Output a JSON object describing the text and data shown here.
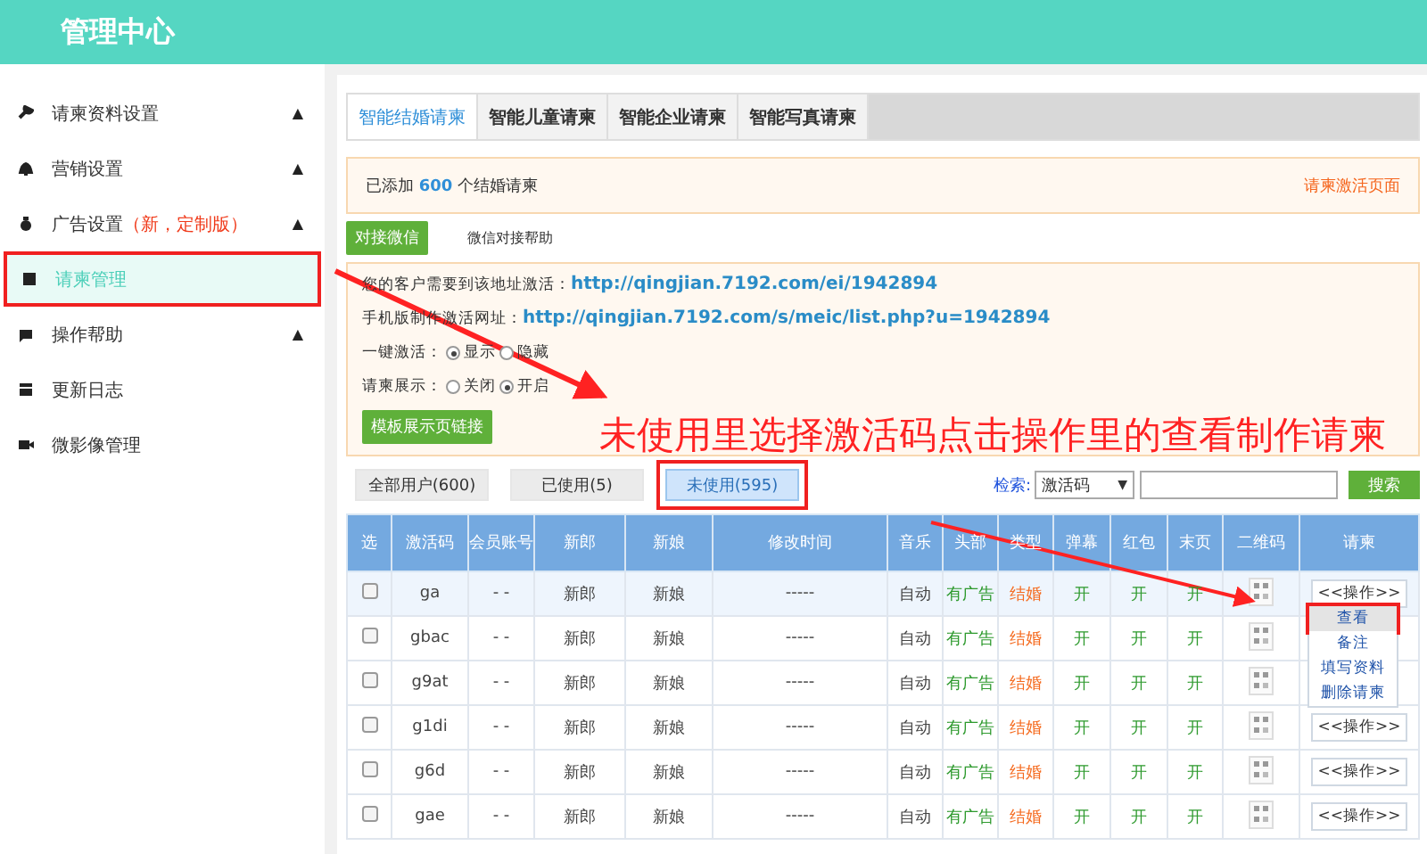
{
  "header": {
    "title": "管理中心"
  },
  "sidebar": {
    "items": [
      {
        "label": "请柬资料设置",
        "caret": "▲",
        "selected": false,
        "highlighted": false
      },
      {
        "label": "营销设置",
        "caret": "▲",
        "selected": false,
        "highlighted": false
      },
      {
        "label": "广告设置",
        "note": "（新，定制版）",
        "caret": "▲",
        "selected": false,
        "highlighted": false
      },
      {
        "label": "请柬管理",
        "selected": true,
        "highlighted": true
      },
      {
        "label": "操作帮助",
        "caret": "▲",
        "selected": false,
        "highlighted": false
      },
      {
        "label": "更新日志",
        "selected": false,
        "highlighted": false
      },
      {
        "label": "微影像管理",
        "selected": false,
        "highlighted": false
      }
    ]
  },
  "tabs": [
    {
      "label": "智能结婚请柬",
      "selected": true
    },
    {
      "label": "智能儿童请柬",
      "selected": false
    },
    {
      "label": "智能企业请柬",
      "selected": false
    },
    {
      "label": "智能写真请柬",
      "selected": false
    }
  ],
  "notice": {
    "prefix": "已添加",
    "count": "600",
    "suffix": "个结婚请柬",
    "link": "请柬激活页面"
  },
  "actions": [
    {
      "label": "对接微信",
      "kind": "button"
    },
    {
      "label": "微信对接帮助",
      "kind": "link"
    }
  ],
  "info": {
    "lines": [
      {
        "label": "您的客户需要到该地址激活：",
        "url": "http://qingjian.7192.com/ei/1942894"
      },
      {
        "label": "手机版制作激活网址：",
        "url": "http://qingjian.7192.com/s/meic/list.php?u=1942894"
      }
    ],
    "radios": [
      {
        "label": "一键激活：",
        "options": [
          {
            "label": "显示",
            "selected": true
          },
          {
            "label": "隐藏",
            "selected": false
          }
        ]
      },
      {
        "label": "请柬展示：",
        "options": [
          {
            "label": "关闭",
            "selected": false
          },
          {
            "label": "开启",
            "selected": true
          }
        ]
      }
    ],
    "button": "模板展示页链接"
  },
  "filters": [
    {
      "label": "全部用户(600)",
      "selected": false,
      "highlighted": false
    },
    {
      "label": "已使用(5)",
      "selected": false,
      "highlighted": false
    },
    {
      "label": "未使用(595)",
      "selected": true,
      "highlighted": true
    }
  ],
  "search": {
    "label": "检索:",
    "select": "激活码",
    "select_arrow": "▼",
    "button": "搜索"
  },
  "table": {
    "columns": [
      {
        "label": "选",
        "kind": "check"
      },
      {
        "label": "激活码",
        "kind": "code"
      },
      {
        "label": "会员账号",
        "kind": "text"
      },
      {
        "label": "新郎",
        "kind": "text"
      },
      {
        "label": "新娘",
        "kind": "text"
      },
      {
        "label": "修改时间",
        "kind": "text"
      },
      {
        "label": "音乐",
        "kind": "text"
      },
      {
        "label": "头部",
        "kind": "ad"
      },
      {
        "label": "类型",
        "kind": "type"
      },
      {
        "label": "弹幕",
        "kind": "switch"
      },
      {
        "label": "红包",
        "kind": "switch"
      },
      {
        "label": "末页",
        "kind": "switch"
      },
      {
        "label": "二维码",
        "kind": "qr"
      },
      {
        "label": "请柬",
        "kind": "action"
      }
    ],
    "rows": [
      {
        "checked": false,
        "cells": [
          "",
          "ga",
          "- -",
          "新郎",
          "新娘",
          "-----",
          "自动",
          "有广告",
          "结婚",
          "开",
          "开",
          "开",
          "",
          "<<操作>>"
        ]
      },
      {
        "checked": false,
        "cells": [
          "",
          "gbac",
          "- -",
          "新郎",
          "新娘",
          "-----",
          "自动",
          "有广告",
          "结婚",
          "开",
          "开",
          "开",
          "",
          ""
        ]
      },
      {
        "checked": false,
        "cells": [
          "",
          "g9at",
          "- -",
          "新郎",
          "新娘",
          "-----",
          "自动",
          "有广告",
          "结婚",
          "开",
          "开",
          "开",
          "",
          ""
        ]
      },
      {
        "checked": false,
        "cells": [
          "",
          "g1di",
          "- -",
          "新郎",
          "新娘",
          "-----",
          "自动",
          "有广告",
          "结婚",
          "开",
          "开",
          "开",
          "",
          "<<操作>>"
        ]
      },
      {
        "checked": false,
        "cells": [
          "",
          "g6d",
          "- -",
          "新郎",
          "新娘",
          "-----",
          "自动",
          "有广告",
          "结婚",
          "开",
          "开",
          "开",
          "",
          "<<操作>>"
        ]
      },
      {
        "checked": false,
        "cells": [
          "",
          "gae",
          "- -",
          "新郎",
          "新娘",
          "-----",
          "自动",
          "有广告",
          "结婚",
          "开",
          "开",
          "开",
          "",
          "<<操作>>"
        ]
      }
    ]
  },
  "menu": {
    "items": [
      {
        "label": "查看",
        "selected": true,
        "highlighted": true
      },
      {
        "label": "备注",
        "selected": false,
        "highlighted": false
      },
      {
        "label": "填写资料",
        "selected": false,
        "highlighted": false
      },
      {
        "label": "删除请柬",
        "selected": false,
        "highlighted": false
      }
    ]
  },
  "annotation": {
    "text": "未使用里选择激活码点击操作里的查看制作请柬"
  }
}
